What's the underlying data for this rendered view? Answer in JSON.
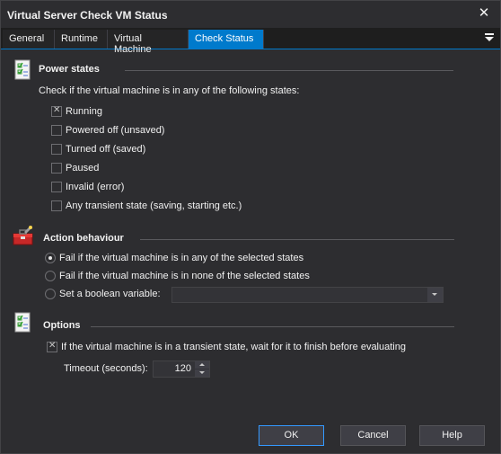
{
  "window": {
    "title": "Virtual Server Check VM Status"
  },
  "tabs": [
    {
      "label": "General"
    },
    {
      "label": "Runtime"
    },
    {
      "label": "Virtual Machine"
    },
    {
      "label": "Check Status",
      "active": true
    }
  ],
  "power_states": {
    "title": "Power states",
    "description": "Check if the virtual machine is in any of the following states:",
    "options": [
      {
        "label": "Running",
        "checked": true
      },
      {
        "label": "Powered off (unsaved)",
        "checked": false
      },
      {
        "label": "Turned off (saved)",
        "checked": false
      },
      {
        "label": "Paused",
        "checked": false
      },
      {
        "label": "Invalid (error)",
        "checked": false
      },
      {
        "label": "Any transient state (saving, starting etc.)",
        "checked": false
      }
    ]
  },
  "action_behaviour": {
    "title": "Action behaviour",
    "options": [
      {
        "label": "Fail if the virtual machine is in any of the selected states",
        "selected": true
      },
      {
        "label": "Fail if the virtual machine is in none of the selected states",
        "selected": false
      },
      {
        "label": "Set a boolean variable:",
        "selected": false
      }
    ],
    "variable_value": ""
  },
  "options": {
    "title": "Options",
    "wait_label": "If the virtual machine is in a transient state, wait for it to finish before evaluating",
    "wait_checked": true,
    "timeout_label": "Timeout (seconds):",
    "timeout_value": "120"
  },
  "buttons": {
    "ok": "OK",
    "cancel": "Cancel",
    "help": "Help"
  },
  "colors": {
    "accent": "#007acc",
    "background": "#2d2d30",
    "text": "#f1f1f1"
  }
}
